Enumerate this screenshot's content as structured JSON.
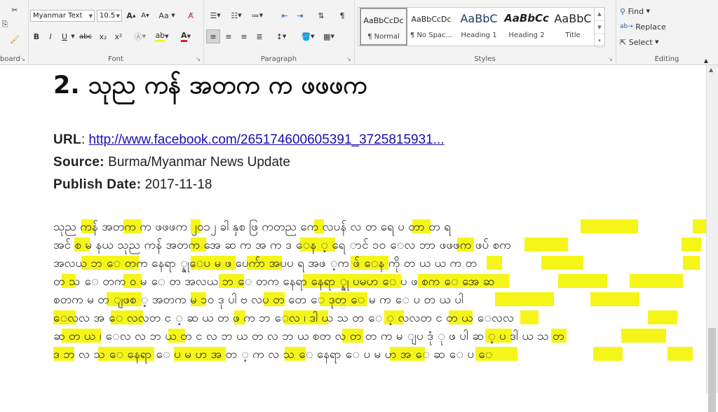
{
  "ribbon": {
    "clipboard_label": "board",
    "font": {
      "label": "Font",
      "name": "Myanmar Text",
      "size": "10.5",
      "grow": "A",
      "shrink": "A",
      "case": "Aa",
      "bold": "B",
      "italic": "I",
      "underline": "U",
      "strike": "abc",
      "sub": "x₂",
      "super": "x²"
    },
    "paragraph": {
      "label": "Paragraph"
    },
    "styles": {
      "label": "Styles",
      "items": [
        {
          "sample": "AaBbCcDc",
          "name": "¶ Normal"
        },
        {
          "sample": "AaBbCcDc",
          "name": "¶ No Spac..."
        },
        {
          "sample": "AaBbC",
          "name": "Heading 1"
        },
        {
          "sample": "AaBbCc",
          "name": "Heading 2"
        },
        {
          "sample": "AaBbC",
          "name": "Title"
        }
      ]
    },
    "editing": {
      "label": "Editing",
      "find": "Find",
      "replace": "Replace",
      "select": "Select"
    }
  },
  "document": {
    "heading": "2. သုည ကန် အတက က ဖဖဖက",
    "url_label": "URL",
    "url_value": "http://www.facebook.com/265174600605391_3725815931...",
    "source_label": "Source",
    "source_value": "Burma/Myanmar News Update",
    "date_label": "Publish Date",
    "date_value": "2017-11-18",
    "lines": [
      "သုည ကန် အတက က ဖဖဖက ၂၀၁၂ ခါ နှစ ဖြ ကတည ကေ လပန် လ  တ ရေ ပ တာ တ ရ",
      "အင် စ မ နယ သုည ကန် အတက အေ ဆ က အ က ဒ ေန ့ ရေ ာင် ၁၀ ေလ ဘာ ဖဖဖက ဖပ် စက",
      "အလယ ဘ ေ တက နေရာ ္နုေပ မ ဖ ပေက်ာ အပပ ရ အဖ ့က  ဖ် ေန ကို တ ယ ယ က တ",
      "တ သ ေ တက ဝ  မ ေ တ အလယ ဘ ေ တက နေရာ နေရာ ္နု ပမဟ ေ ပ ဖ စက ေ အေ ဆ",
      "စတက မ တ ျဖစ ့  အတက မ ၁၀ ဒု ပါ ဗ လပ တ တေ ေ ဒုတ္ ေ မ က ေ ပ  တ ယ ပါ",
      "ေလလ အ ေ လလတ င ့ ဆ ယ တ ဖ က ဘ ေလ ၊ ဒါ ယ သ တ ေ ့ လလတ င တ ယ ေလလ",
      "ဆ တ ယ ၊ ေလ လ ဘ ယ တ င လ ဘ ယ  တ လ ဘ ယ  စတ လ တ တ က မ ျပ ဒုံ ု ဖ ပါ ဆ ့ ပ ဒါ ယ သ တ",
      "ဒ ဘ လ သ ေ နေရာ ေ ပ မ ဟ  အ  တ ့ က လ သ ေ နေရာ ေ ပ မ ဟ အ ေ ဆ ေ ပ ေ"
    ]
  }
}
